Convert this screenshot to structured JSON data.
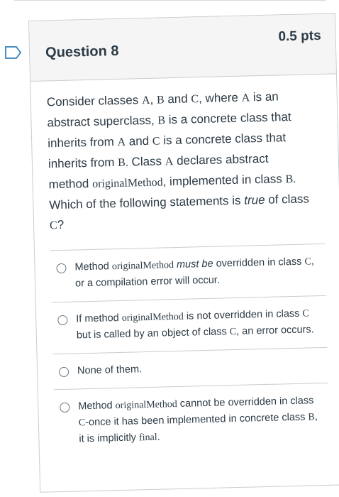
{
  "question": {
    "title": "Question 8",
    "points": "0.5 pts",
    "text": {
      "p1": "Consider classes ",
      "A": "A",
      "comma1": ", ",
      "B": "B",
      "and1": " and ",
      "C": "C",
      "p2": ", where ",
      "A2": "A",
      "p3": " is an abstract superclass, ",
      "B2": "B",
      "p4": " is a concrete class that inherits from ",
      "A3": "A",
      "p5": " and ",
      "C2": "C",
      "p6": " is a concrete class that inherits from ",
      "B3": "B.",
      "p7": " Class ",
      "A4": "A",
      "p8": " declares abstract method ",
      "method": "originalMethod",
      "p9": ", implemented in class ",
      "B4": "B.",
      "p10": " Which of the following statements is ",
      "true": "true",
      "p11": " of class ",
      "C3": "C",
      "p12": "?"
    }
  },
  "answers": [
    {
      "t1": "Method ",
      "m": "originalMethod",
      "t2": " must be",
      "t3": " overridden in class ",
      "c": "C",
      "t4": ", or a compilation error will occur."
    },
    {
      "t1": "If method ",
      "m": "originalMethod",
      "t2": " is not overridden in class ",
      "c": "C",
      "t3": " but is called by an object of class ",
      "c2": "C",
      "t4": ", an error occurs."
    },
    {
      "t1": "None of them."
    },
    {
      "t1": "Method ",
      "m": "originalMethod",
      "t2": " cannot be overridden in class ",
      "c": "C",
      "t3": "-once it has been implemented in concrete class ",
      "b": "B",
      "t4": ", it is implicitly ",
      "f": "final",
      "t5": "."
    }
  ]
}
